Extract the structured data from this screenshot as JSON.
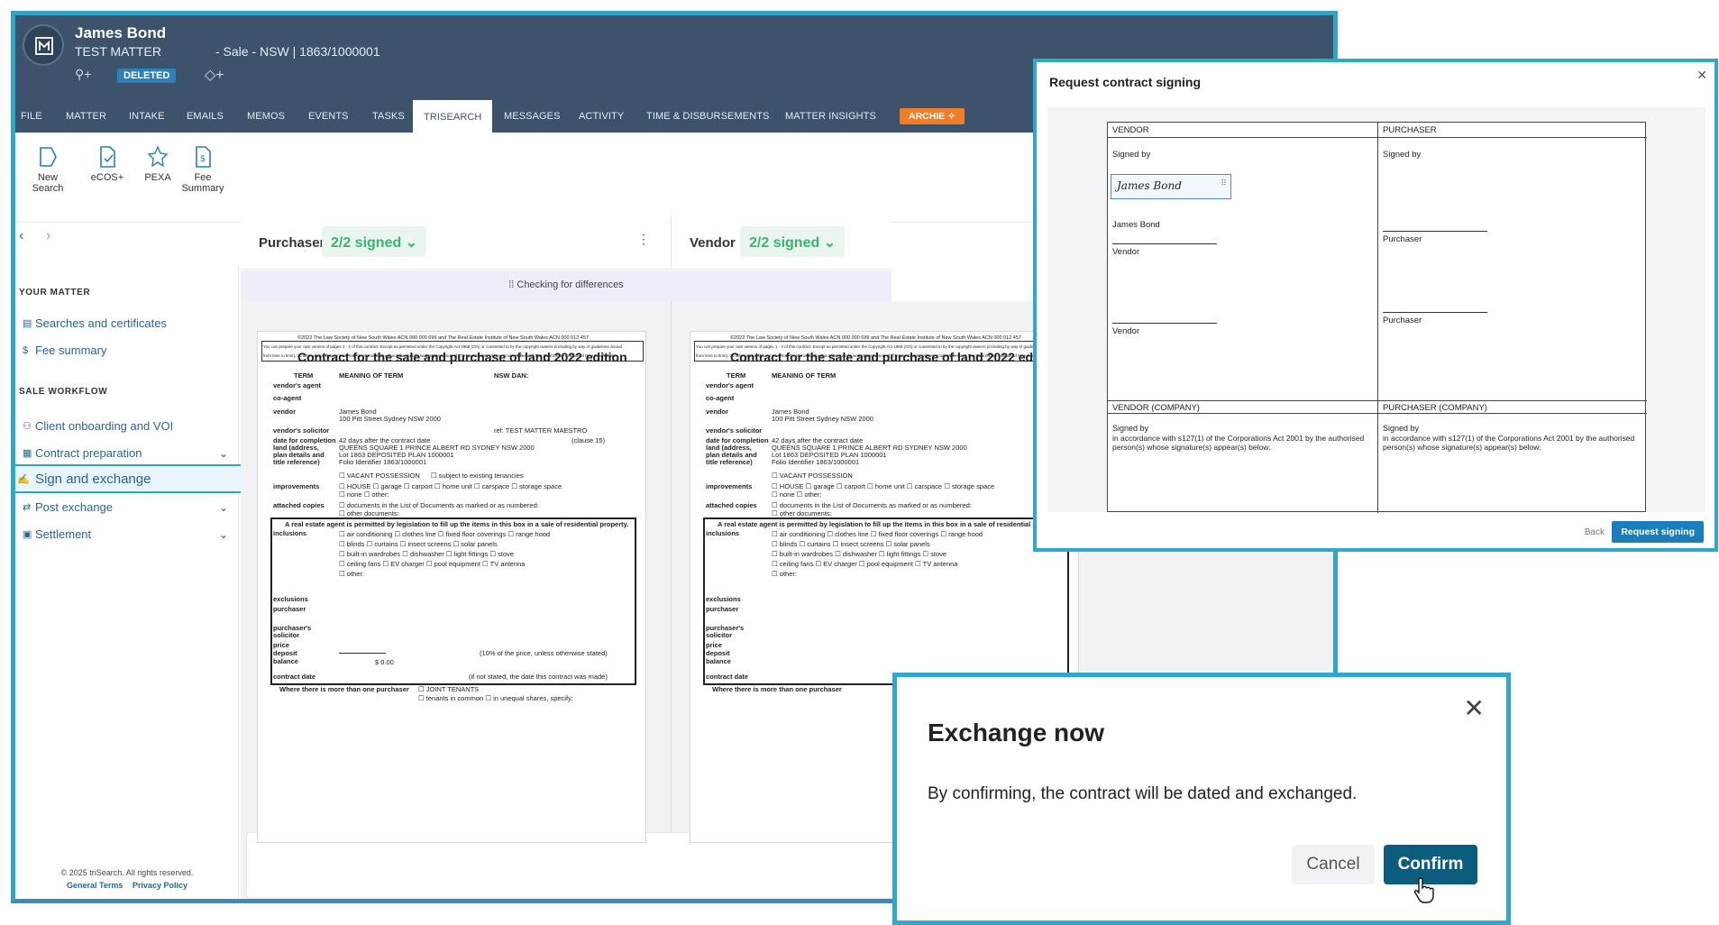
{
  "header": {
    "name": "James Bond",
    "matter": "TEST MATTER",
    "description": "- Sale - NSW | 1863/1000001",
    "badge": "DELETED"
  },
  "tabs": [
    "FILE",
    "MATTER",
    "INTAKE",
    "EMAILS",
    "MEMOS",
    "EVENTS",
    "TASKS",
    "TRISEARCH",
    "MESSAGES",
    "ACTIVITY",
    "TIME & DISBURSEMENTS",
    "MATTER INSIGHTS"
  ],
  "active_tab": "TRISEARCH",
  "archie": "ARCHIE",
  "toolbar": [
    {
      "line1": "New",
      "line2": "Search"
    },
    {
      "line1": "eCOS+",
      "line2": ""
    },
    {
      "line1": "PEXA",
      "line2": ""
    },
    {
      "line1": "Fee",
      "line2": "Summary"
    }
  ],
  "sidebar": {
    "your_matter": "YOUR MATTER",
    "matter_items": [
      "Searches and certificates",
      "Fee summary"
    ],
    "sale_workflow": "SALE WORKFLOW",
    "workflow_items": [
      "Client onboarding and VOI",
      "Contract preparation",
      "Sign and exchange",
      "Post exchange",
      "Settlement"
    ],
    "copyright": "© 2025 triSearch. All rights reserved.",
    "links": [
      "General Terms",
      "Privacy Policy"
    ]
  },
  "panels": {
    "purchaser_label": "Purchaser",
    "purchaser_status": "2/2 signed",
    "vendor_label": "Vendor",
    "vendor_status": "2/2 signed",
    "diff": "Checking for differences"
  },
  "contract": {
    "copyright": "©2022 The Law Society of New South Wales ACN 000 000 699 and The Real Estate Institute of New South Wales ACN 000 012 457",
    "notice": "You can prepare your own version of pages 1 - 4 of this contract. Except as permitted under the Copyright Act 1968 (Cth) or consented to by the copyright owners (including by way of guidelines issued",
    "notice2": "from time to time), no other part of this contract may be reproduced without the specific written permission of The Law Society of New South Wales and The Real Estate Institute of New South Wales.",
    "title": "Contract for the sale and purchase of land 2022 edition",
    "col_term": "TERM",
    "col_meaning": "MEANING OF TERM",
    "col_dan": "NSW DAN:",
    "vendors_agent": "vendor's agent",
    "co_agent": "co-agent",
    "vendor": "vendor",
    "vendor_name": "James Bond",
    "vendor_addr": "100 Pitt Street Sydney NSW 2000",
    "vendors_solicitor": "vendor's solicitor",
    "ref": "ref: TEST MATTER MAESTRO",
    "completion": "date for completion",
    "completion_val": "42 days after the contract date",
    "clause": "(clause 15)",
    "land1": "land (address,",
    "land2": "plan details and",
    "land3": "title reference)",
    "land_addr": "QUEENS SQUARE 1 PRINCE ALBERT RD SYDNEY NSW 2000",
    "land_plan": "Lot 1863 DEPOSITED PLAN 1000001",
    "land_folio": "Folio Identifier 1863/1000001",
    "vacant": "☐ VACANT POSSESSION",
    "tenancies": "☐ subject to existing tenancies",
    "improvements": "improvements",
    "house_row": "☐ HOUSE   ☐ garage   ☐ carport   ☐ home unit   ☐ carspace   ☐ storage space",
    "none_row": "☐ none     ☐ other:",
    "attached": "attached copies",
    "docs1": "☐ documents in the List of Documents as marked or as numbered:",
    "docs2": "☐ other documents:",
    "agent_box": "A real estate agent is permitted by legislation to fill up the items in this box in a sale of residential property.",
    "inclusions": "inclusions",
    "inc_rows": [
      "☐ air conditioning      ☐ clothes line      ☐ fixed floor coverings   ☐ range hood",
      "☐ blinds                    ☐ curtains             ☐ insect screens           ☐ solar panels",
      "☐ built-in wardrobes   ☐ dishwasher        ☐ light fittings             ☐ stove",
      "☐ ceiling fans            ☐ EV charger         ☐ pool equipment         ☐ TV antenna",
      "☐ other:"
    ],
    "exclusions": "exclusions",
    "purchaser": "purchaser",
    "p_solicitor1": "purchaser's",
    "p_solicitor2": "solicitor",
    "price": "price",
    "deposit": "deposit",
    "balance": "balance",
    "balance_val": "$ 0.00",
    "ten_pct": "(10% of the price, unless otherwise stated)",
    "contract_date": "contract date",
    "not_stated": "(if not stated, the date this contract was made)",
    "more_than": "Where there is more than one purchaser",
    "joint": "☐ JOINT TENANTS",
    "tenants_common": "☐ tenants in common  ☐ in unequal shares, specify:"
  },
  "request_dialog": {
    "title": "Request contract signing",
    "vendor_h": "VENDOR",
    "purchaser_h": "PURCHASER",
    "signed_by": "Signed by",
    "signature": "James Bond",
    "signer_name": "James Bond",
    "vendor_label": "Vendor",
    "purchaser_label": "Purchaser",
    "vendor_company_h": "VENDOR (COMPANY)",
    "purchaser_company_h": "PURCHASER (COMPANY)",
    "corp_text": "in accordance with s127(1) of the Corporations Act 2001 by the authorised person(s) whose signature(s) appear(s) below:",
    "back": "Back",
    "request": "Request signing"
  },
  "exchange_dialog": {
    "title": "Exchange now",
    "message": "By confirming, the contract will be dated and exchanged.",
    "cancel": "Cancel",
    "confirm": "Confirm"
  },
  "colors": {
    "header_bg": "#3d536c",
    "accent_border": "#2fa8cc",
    "signed_green": "#3bb36b",
    "confirm_bg": "#0c5c7e",
    "archie_orange": "#f07e27"
  }
}
